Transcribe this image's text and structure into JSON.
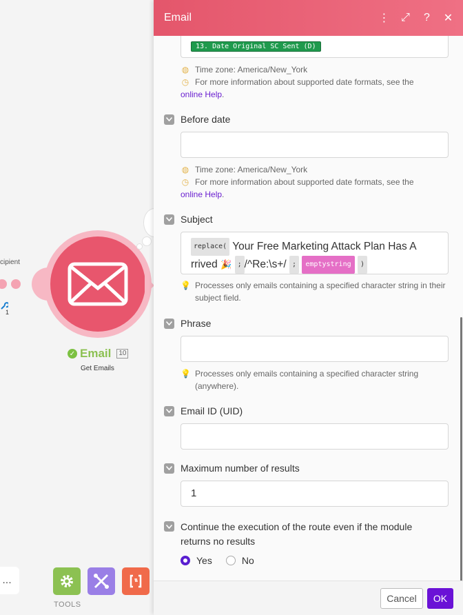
{
  "canvas": {
    "recipient_label": "cipient",
    "wrench_count": "1",
    "module": {
      "title": "Email",
      "count": "10",
      "subtitle": "Get Emails"
    },
    "more_label": "...",
    "tools_label": "TOOLS"
  },
  "panel": {
    "title": "Email",
    "header_icons": [
      "more-vert-icon",
      "expand-icon",
      "help-icon",
      "close-icon"
    ],
    "header_glyphs": {
      "more": "⋮",
      "expand": "⤢",
      "help": "?",
      "close": "✕"
    },
    "top_field": {
      "token": "13. Date Original SC Sent (D)",
      "hint_timezone": "Time zone: America/New_York",
      "hint_formats": "For more information about supported date formats, see the",
      "hint_link": "online Help",
      "hint_end": "."
    },
    "before_date": {
      "label": "Before date",
      "value": "",
      "hint_timezone": "Time zone: America/New_York",
      "hint_formats": "For more information about supported date formats, see the",
      "hint_link": "online Help",
      "hint_end": "."
    },
    "subject": {
      "label": "Subject",
      "fn": "replace(",
      "text_a": "Your Free Marketing Attack Plan Has A",
      "text_b": "rrived",
      "emoji": "🎉",
      "semi1": ";",
      "regex": "/^Re:\\s+/",
      "semi2": ";",
      "keyword": "emptystring",
      "close": ")",
      "hint": "Processes only emails containing a specified character string in their subject field."
    },
    "phrase": {
      "label": "Phrase",
      "value": "",
      "hint": "Processes only emails containing a specified character string (anywhere)."
    },
    "email_id": {
      "label": "Email ID (UID)",
      "value": ""
    },
    "max_results": {
      "label": "Maximum number of results",
      "value": "1"
    },
    "continue_route": {
      "label": "Continue the execution of the route even if the module returns no results",
      "options": [
        "Yes",
        "No"
      ],
      "selected": "Yes"
    },
    "footer": {
      "cancel": "Cancel",
      "ok": "OK"
    }
  },
  "colors": {
    "accent": "#e4566b",
    "ok_button": "#6a12d6",
    "link": "#6a1fd0",
    "token_green": "#1f9a4d",
    "keyword_pink": "#e56fc6"
  }
}
